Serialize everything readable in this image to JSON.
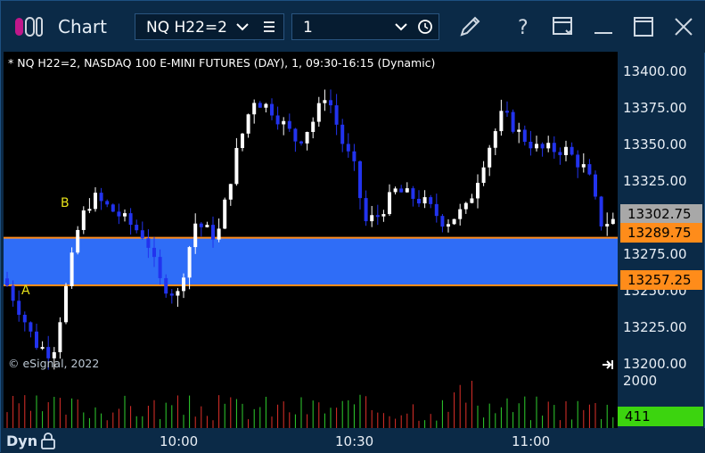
{
  "window": {
    "title": "Chart",
    "symbol": "NQ H22=2",
    "interval": "1"
  },
  "chart": {
    "info_line": "* NQ H22=2, NASDAQ 100 E-MINI FUTURES (DAY), 1, 09:30-16:15 (Dynamic)",
    "copyright": "© eSignal, 2022",
    "marker_a": "A",
    "marker_b": "B",
    "price_labels": [
      "13400.00",
      "13375.00",
      "13350.00",
      "13325.00",
      "13275.00",
      "13250.00",
      "13225.00",
      "13200.00"
    ],
    "last_price": "13302.75",
    "zone_top": "13289.75",
    "zone_bottom": "13257.25",
    "volume_label": "2000",
    "volume_value": "411",
    "time_labels": [
      "10:00",
      "10:30",
      "11:00"
    ],
    "footer_mode": "Dyn",
    "colors": {
      "zone": "#2f6df7",
      "zone_edge": "#ff8c1a",
      "up_candle": "#ffffff",
      "down_candle": "#2233ee",
      "last_price_bg": "#a8a8a8",
      "volume_bg": "#3cd40f"
    }
  },
  "chart_data": {
    "type": "candlestick",
    "x": "1-minute bars",
    "ylim": [
      13200,
      13412
    ],
    "zone": [
      13257.25,
      13289.75
    ],
    "markers": [
      {
        "label": "A",
        "price": 13250
      },
      {
        "label": "B",
        "price": 13300
      }
    ]
  }
}
